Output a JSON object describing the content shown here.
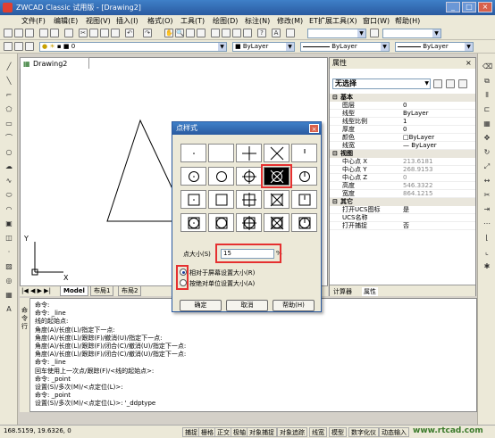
{
  "window": {
    "title": "ZWCAD Classic 试用版 - [Drawing2]"
  },
  "menu": [
    "文件(F)",
    "编辑(E)",
    "视图(V)",
    "插入(I)",
    "格式(O)",
    "工具(T)",
    "绘图(D)",
    "标注(N)",
    "修改(M)",
    "ET扩展工具(X)",
    "窗口(W)",
    "帮助(H)"
  ],
  "toolbar": {
    "layer_value": "0",
    "color_value": "ByLayer",
    "linetype_value": "ByLayer",
    "lineweight_value": "ByLayer"
  },
  "drawing": {
    "tab": "Drawing2",
    "axis_x": "X",
    "axis_y": "Y"
  },
  "layout_tabs": [
    "Model",
    "布局1",
    "布局2"
  ],
  "properties": {
    "title": "属性",
    "selection": "无选择",
    "groups": [
      {
        "name": "基本",
        "rows": [
          [
            "图层",
            "0"
          ],
          [
            "线型",
            "ByLayer"
          ],
          [
            "线型比例",
            "1"
          ],
          [
            "厚度",
            "0"
          ],
          [
            "颜色",
            "□ByLayer"
          ],
          [
            "线宽",
            "— ByLayer"
          ]
        ]
      },
      {
        "name": "视图",
        "rows": [
          [
            "中心点 X",
            "213.6181"
          ],
          [
            "中心点 Y",
            "268.9153"
          ],
          [
            "中心点 Z",
            "0"
          ],
          [
            "高度",
            "546.3322"
          ],
          [
            "宽度",
            "864.1215"
          ]
        ]
      },
      {
        "name": "其它",
        "rows": [
          [
            "打开UCS图标",
            "是"
          ],
          [
            "UCS名称",
            ""
          ],
          [
            "打开捕捉",
            "否"
          ]
        ]
      }
    ],
    "bottom_tabs": [
      "计算器",
      "属性"
    ]
  },
  "dialog": {
    "title": "点样式",
    "size_label": "点大小(S)",
    "size_value": "15",
    "size_unit": "%",
    "radio1": "相对于屏幕设置大小(R)",
    "radio2": "按绝对单位设置大小(A)",
    "ok": "确定",
    "cancel": "取消",
    "help": "帮助(H)"
  },
  "command": {
    "side_label": "命令行",
    "lines": [
      "命令:",
      "命令: _line",
      "线的起始点:",
      "角度(A)/长度(L)/指定下一点:",
      "角度(A)/长度(L)/跟踪(F)/撤消(U)/指定下一点:",
      "角度(A)/长度(L)/跟踪(F)/闭合(C)/撤消(U)/指定下一点:",
      "角度(A)/长度(L)/跟踪(F)/闭合(C)/撤消(U)/指定下一点:",
      "命令: _line",
      "回车使用上一次点/跟踪(F)/<线的起始点>:",
      "命令: _point",
      "设置(S)/多次(M)/<点定位(L)>:",
      "命令: _point",
      "设置(S)/多次(M)/<点定位(L)>: '_ddptype"
    ]
  },
  "status": {
    "coords": "168.5159, 19.6326, 0",
    "buttons": [
      "捕捉",
      "栅格",
      "正交",
      "极轴",
      "对象捕捉",
      "对象追踪",
      "线宽",
      "模型",
      "数字化仪",
      "动态输入"
    ]
  },
  "watermark": "www.rtcad.com"
}
